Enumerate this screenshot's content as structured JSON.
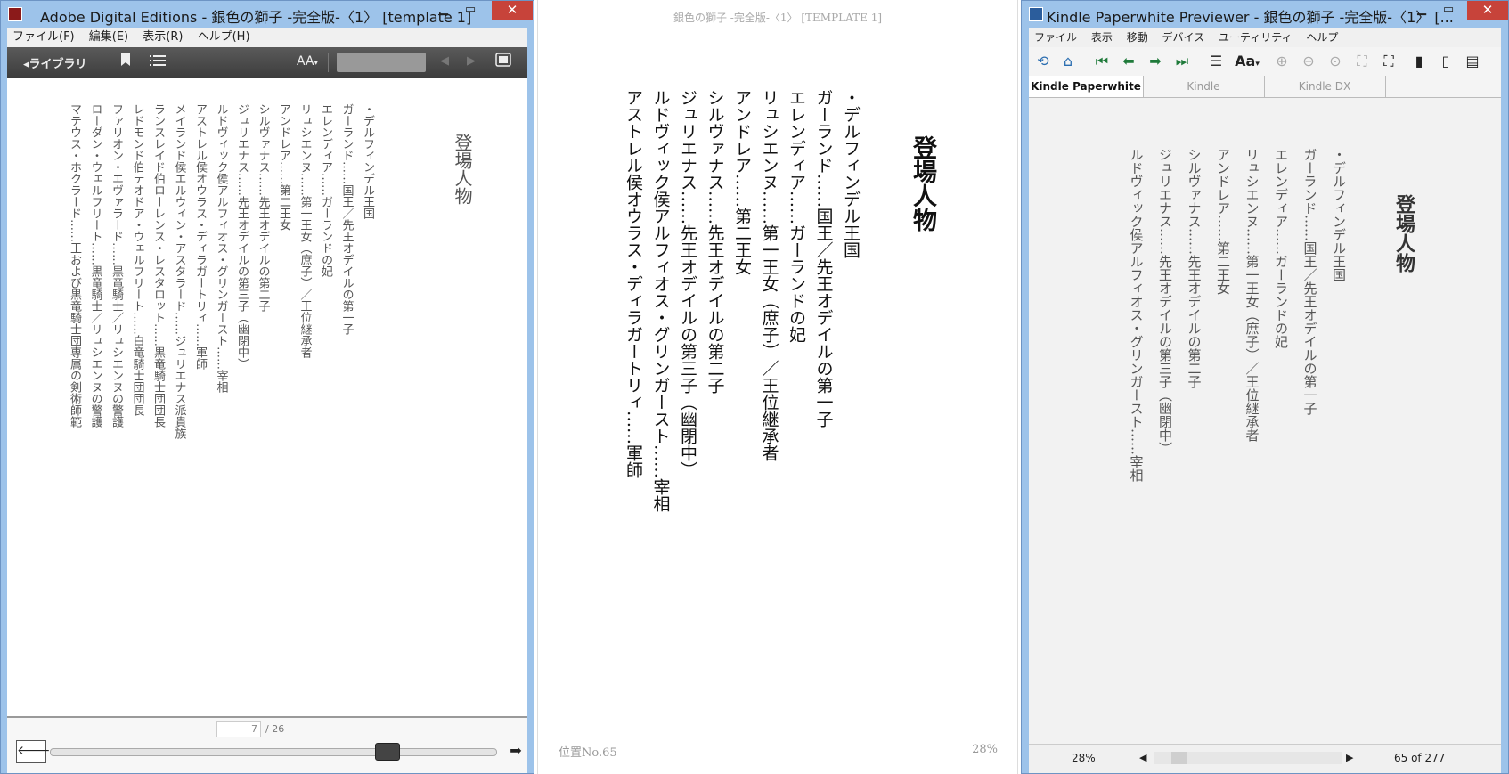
{
  "ade": {
    "title": "Adobe Digital Editions - 銀色の獅子 -完全版-〈1〉 [template 1]",
    "menu": [
      "ファイル(F)",
      "編集(E)",
      "表示(R)",
      "ヘルプ(H)"
    ],
    "library_label": "◂ライブラリ",
    "font_size_label": "AA",
    "page_current": "7",
    "page_total": "/ 26",
    "progress_fraction": 0.755,
    "heading": "登場人物",
    "lines": [
      "・デルフィンデル王国",
      "ガーランド……国王／先王オデイルの第一子",
      "エレンディア……ガーランドの妃",
      "リュシエンヌ……第一王女（庶子）／王位継承者",
      "アンドレア……第二王女",
      "シルヴァナス……先王オデイルの第二子",
      "ジュリエナス……先王オデイルの第三子（幽閉中）",
      "ルドヴィック侯アルフィオス・グリンガースト……宰相",
      "アストレル侯オウラス・ディラガートリィ……軍師",
      "メイランド侯エルウィン・アスタラード……ジュリエナス派貴族",
      "ランスレイド伯ローレンス・レスタロット……黒竜騎士団団長",
      "レドモンド伯テオドア・ウェルフリート……白竜騎士団団長",
      "ファリオン・エヴァラード……黒竜騎士／リュシエンヌの警護",
      "ローダン・ウェルフリート……黒竜騎士／リュシエンヌの警護",
      "マテウス・ホクラード……王および黒竜騎士団専属の剣術師範"
    ]
  },
  "middle": {
    "header": "銀色の獅子 -完全版-〈1〉 [TEMPLATE 1]",
    "heading": "登場人物",
    "lines": [
      "・デルフィンデル王国",
      "ガーランド……国王／先王オデイルの第一子",
      "エレンディア……ガーランドの妃",
      "リュシエンヌ……第一王女（庶子）／王位継承者",
      "アンドレア……第二王女",
      "シルヴァナス……先王オデイルの第二子",
      "ジュリエナス……先王オデイルの第三子（幽閉中）",
      "ルドヴィック侯アルフィオス・グリンガースト……宰相",
      "アストレル侯オウラス・ディラガートリィ……軍師"
    ],
    "location": "位置No.65",
    "percent": "28%"
  },
  "kpw": {
    "title": "Kindle Paperwhite Previewer - 銀色の獅子 -完全版-〈1〉 [...",
    "menu": [
      "ファイル",
      "表示",
      "移動",
      "デバイス",
      "ユーティリティ",
      "ヘルプ"
    ],
    "font_label": "Aa",
    "tabs": [
      "Kindle Paperwhite",
      "Kindle",
      "Kindle DX"
    ],
    "heading": "登場人物",
    "lines": [
      "・デルフィンデル王国",
      "ガーランド……国王／先王オデイルの第一子",
      "エレンディア……ガーランドの妃",
      "リュシエンヌ……第一王女（庶子）／王位継承者",
      "アンドレア……第二王女",
      "シルヴァナス……先王オデイルの第二子",
      "ジュリエナス……先王オデイルの第三子（幽閉中）",
      "ルドヴィック侯アルフィオス・グリンガースト……宰相"
    ],
    "status_percent": "28%",
    "status_page": "65 of 277"
  },
  "colors": {
    "title_bg": "#9dc3ea",
    "close_red": "#c7433a",
    "ade_toolbar": "#4a4a4a",
    "text_gray": "#555555"
  }
}
